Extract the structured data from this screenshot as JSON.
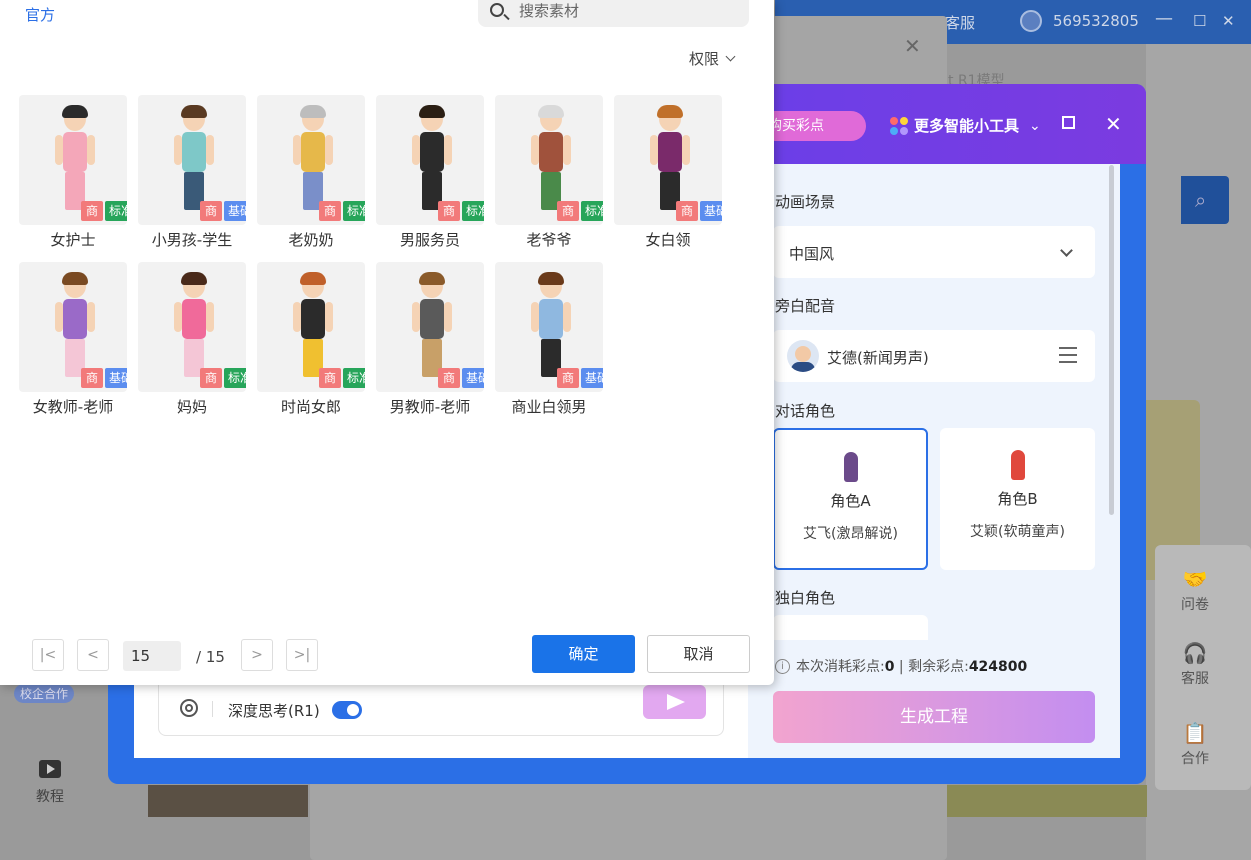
{
  "background": {
    "topbar": {
      "kefu": "客服",
      "user_id": "569532805",
      "minimize": "—",
      "maximize": "☐",
      "close": "✕"
    },
    "r1_text": "t R1模型",
    "side": [
      {
        "icon": "handshake-icon",
        "glyph": "🤝",
        "label": "问卷"
      },
      {
        "icon": "headset-icon",
        "glyph": "🎧",
        "label": "客服"
      },
      {
        "icon": "document-icon",
        "glyph": "📋",
        "label": "合作"
      }
    ],
    "tutorial_label": "教程",
    "badge": "校企合作",
    "dialog_close": "✕"
  },
  "generator": {
    "buy_label": "购买彩点",
    "tools_label": "更多智能小工具",
    "tools_icon_colors": [
      "#ff6b6b",
      "#ffd43b",
      "#4dabf7",
      "#b197fc"
    ],
    "scene": {
      "label": "动画场景",
      "value": "中国风"
    },
    "voice": {
      "label": "旁白配音",
      "value": "艾德(新闻男声)"
    },
    "dialog": {
      "label": "对话角色",
      "roles": [
        {
          "name": "角色A",
          "voice": "艾飞(激昂解说)",
          "color": "#6b4a8a",
          "selected": true
        },
        {
          "name": "角色B",
          "voice": "艾颖(软萌童声)",
          "color": "#e0483c",
          "selected": false
        }
      ]
    },
    "solo_label": "独白角色",
    "cost": {
      "prefix": "本次消耗彩点:",
      "used": "0",
      "sep": " | ",
      "remain_prefix": "剩余彩点:",
      "remain": "424800"
    },
    "generate_label": "生成工程",
    "deep_think_label": "深度思考(R1)",
    "deep_think_on": true
  },
  "picker": {
    "tab": "官方",
    "search_placeholder": "搜索素材",
    "perm_filter": "权限",
    "tag_shang": "商",
    "tag_colors": {
      "标准": "#27a55a",
      "基础": "#5b8def"
    },
    "characters": [
      {
        "name": "女护士",
        "level": "标准",
        "hair": "#2b2b2b",
        "body": "#f4a7b9",
        "legs": "#f4a7b9"
      },
      {
        "name": "小男孩-学生",
        "level": "基础",
        "hair": "#5a3a22",
        "body": "#7ec8c8",
        "legs": "#3a5a78"
      },
      {
        "name": "老奶奶",
        "level": "标准",
        "hair": "#bdbdbd",
        "body": "#e6b84a",
        "legs": "#7a8fc9"
      },
      {
        "name": "男服务员",
        "level": "标准",
        "hair": "#2b1f14",
        "body": "#2b2b2b",
        "legs": "#2b2b2b"
      },
      {
        "name": "老爷爷",
        "level": "标准",
        "hair": "#d9d9d9",
        "body": "#a0523c",
        "legs": "#4a8a4a"
      },
      {
        "name": "女白领",
        "level": "基础",
        "hair": "#c0702a",
        "body": "#7a2a6a",
        "legs": "#2b2b2b"
      },
      {
        "name": "女教师-老师",
        "level": "基础",
        "hair": "#7a4a22",
        "body": "#9a6ac8",
        "legs": "#f4c6d6"
      },
      {
        "name": "妈妈",
        "level": "标准",
        "hair": "#4a2a1a",
        "body": "#f06a9a",
        "legs": "#f4c6d6"
      },
      {
        "name": "时尚女郎",
        "level": "标准",
        "hair": "#c0602a",
        "body": "#2b2b2b",
        "legs": "#f0c030"
      },
      {
        "name": "男教师-老师",
        "level": "基础",
        "hair": "#8a5a2a",
        "body": "#5a5a5a",
        "legs": "#c8a068"
      },
      {
        "name": "商业白领男",
        "level": "基础",
        "hair": "#6a3a1a",
        "body": "#8fb8e0",
        "legs": "#2b2b2b"
      }
    ],
    "pagination": {
      "current": "15",
      "total": "/ 15",
      "first": "|<",
      "prev": "<",
      "next": ">",
      "last": ">|"
    },
    "confirm_label": "确定",
    "cancel_label": "取消"
  }
}
